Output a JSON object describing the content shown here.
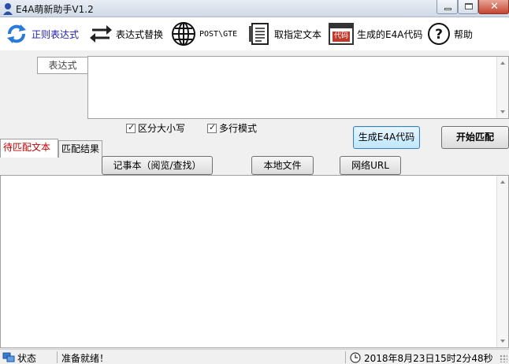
{
  "window": {
    "title": "E4A萌新助手V1.2"
  },
  "toolbar": {
    "items": [
      {
        "label": "正则表达式",
        "icon": "refresh-icon"
      },
      {
        "label": "表达式替换",
        "icon": "swap-arrows-icon"
      },
      {
        "label": "POST\\GTE",
        "icon": "globe-icon"
      },
      {
        "label": "取指定文本",
        "icon": "document-icon"
      },
      {
        "label": "生成的E4A代码",
        "icon": "code-window-icon",
        "icon_text": "代码"
      },
      {
        "label": "帮助",
        "icon": "help-icon"
      }
    ]
  },
  "expression": {
    "label": "表达式",
    "value": ""
  },
  "options": {
    "case_sensitive": {
      "label": "区分大小写",
      "checked": true
    },
    "multiline": {
      "label": "多行模式",
      "checked": true
    }
  },
  "buttons": {
    "generate": "生成E4A代码",
    "start": "开始匹配",
    "notepad": "记事本（阅览/查找）",
    "local_file": "本地文件",
    "network_url": "网络URL"
  },
  "tabs": [
    {
      "label": "待匹配文本",
      "active": true
    },
    {
      "label": "匹配结果",
      "active": false
    }
  ],
  "status": {
    "label": "状态",
    "message": "准备就绪！",
    "datetime": "2018年8月23日15时2分48秒"
  },
  "colors": {
    "active_tab": "#c00000",
    "active_toolbar": "#1b1bb5",
    "accent_button": "#3c7fb1"
  }
}
